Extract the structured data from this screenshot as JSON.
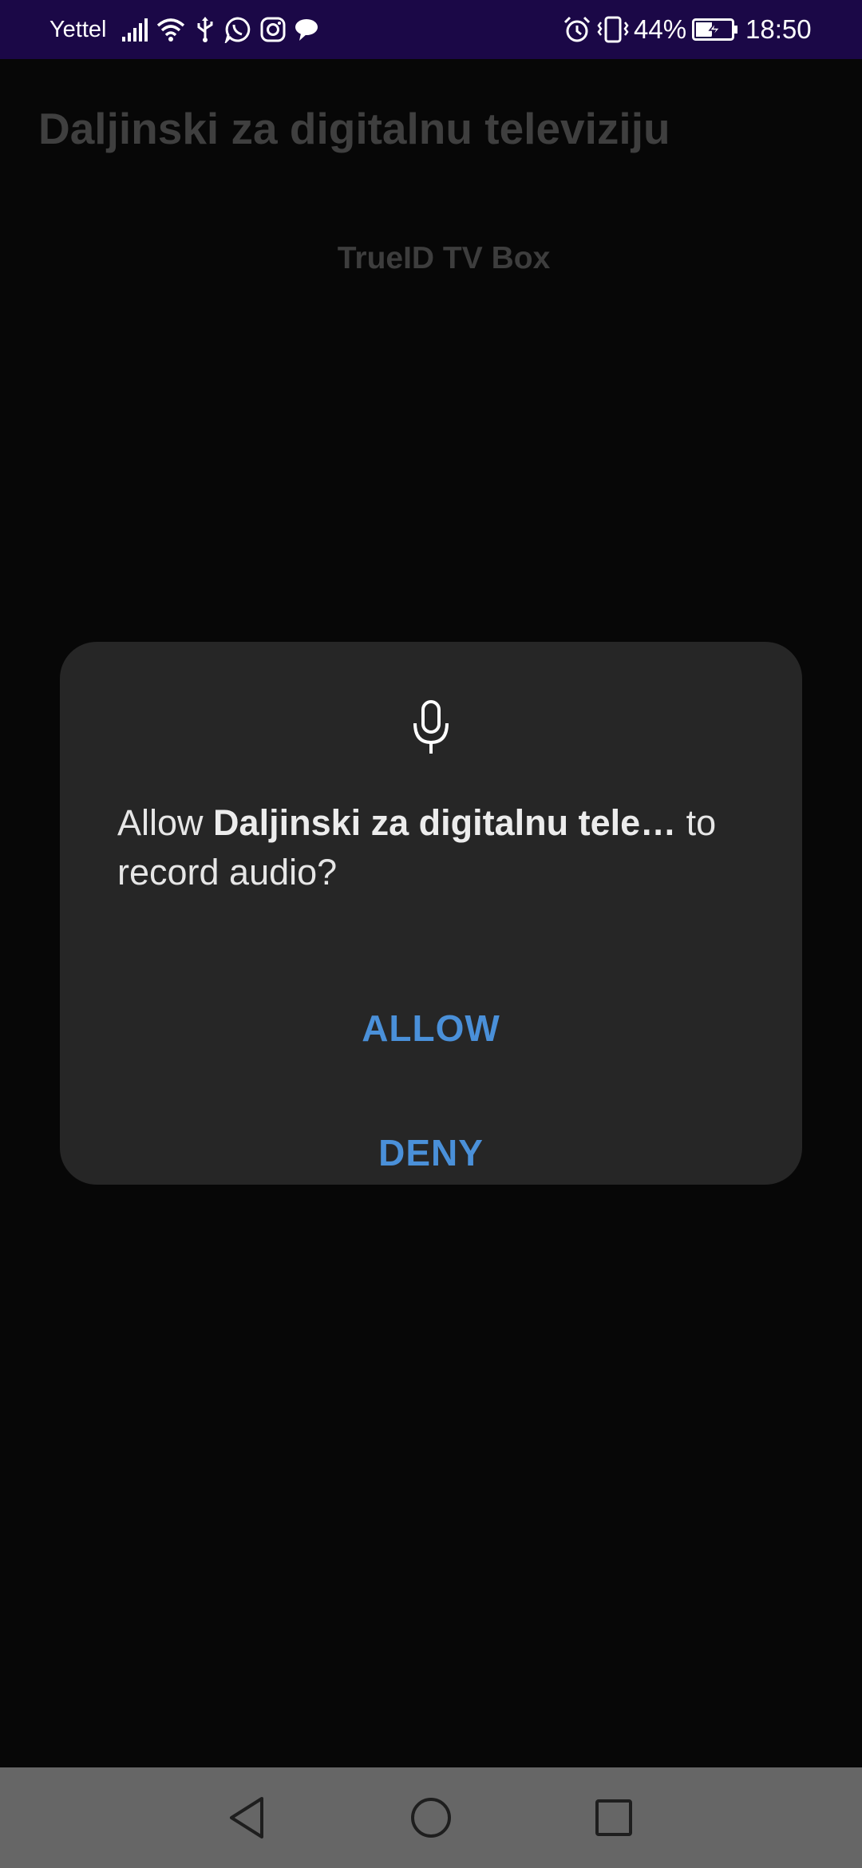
{
  "status_bar": {
    "carrier": "Yettel",
    "icons": [
      "signal-icon",
      "wifi-icon",
      "usb-icon",
      "whatsapp-icon",
      "instagram-icon",
      "chat-icon",
      "alarm-icon",
      "vibrate-icon",
      "battery-charging-icon"
    ],
    "battery_percent": "44%",
    "time": "18:50",
    "background_color": "#1b0847"
  },
  "app": {
    "title": "Daljinski za digitalnu televiziju",
    "device": "TrueID TV Box"
  },
  "dialog": {
    "icon": "microphone-icon",
    "message_prefix": "Allow ",
    "app_name": "Daljinski za digitalnu tele…",
    "message_suffix": " to record audio?",
    "allow_label": "ALLOW",
    "deny_label": "DENY",
    "button_color": "#4a90d9",
    "background_color": "#262626"
  },
  "nav_bar": {
    "buttons": [
      "back-icon",
      "home-icon",
      "recents-icon"
    ],
    "background_color": "#666666"
  }
}
